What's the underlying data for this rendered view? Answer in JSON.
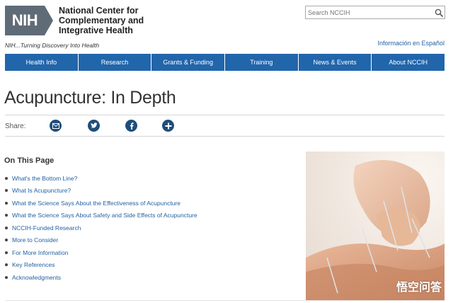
{
  "header": {
    "logo_text": "NIH",
    "center_name_lines": [
      "National Center for",
      "Complementary and",
      "Integrative Health"
    ],
    "tagline": "NIH...Turning Discovery Into Health",
    "spanish_link": "Información en Español"
  },
  "search": {
    "placeholder": "Search NCCIH",
    "icon": "search-icon"
  },
  "nav": {
    "items": [
      {
        "label": "Health Info"
      },
      {
        "label": "Research"
      },
      {
        "label": "Grants & Funding"
      },
      {
        "label": "Training"
      },
      {
        "label": "News & Events"
      },
      {
        "label": "About NCCIH"
      }
    ]
  },
  "page": {
    "title": "Acupuncture: In Depth",
    "share_label": "Share:",
    "share_icons": [
      "email-icon",
      "twitter-icon",
      "facebook-icon",
      "add-icon"
    ]
  },
  "on_this_page": {
    "title": "On This Page",
    "items": [
      {
        "label": "What's the Bottom Line?"
      },
      {
        "label": "What Is Acupuncture?"
      },
      {
        "label": "What the Science Says About the Effectiveness of Acupuncture"
      },
      {
        "label": "What the Science Says About Safety and Side Effects of Acupuncture"
      },
      {
        "label": "NCCIH-Funded Research"
      },
      {
        "label": "More to Consider"
      },
      {
        "label": "For More Information"
      },
      {
        "label": "Key References"
      },
      {
        "label": "Acknowledgments"
      }
    ]
  },
  "watermark": "悟空问答",
  "colors": {
    "nav_bg": "#2165ab",
    "link": "#2361a4",
    "share_icon_bg": "#1f4d7a",
    "logo_gray": "#5f6b77"
  }
}
